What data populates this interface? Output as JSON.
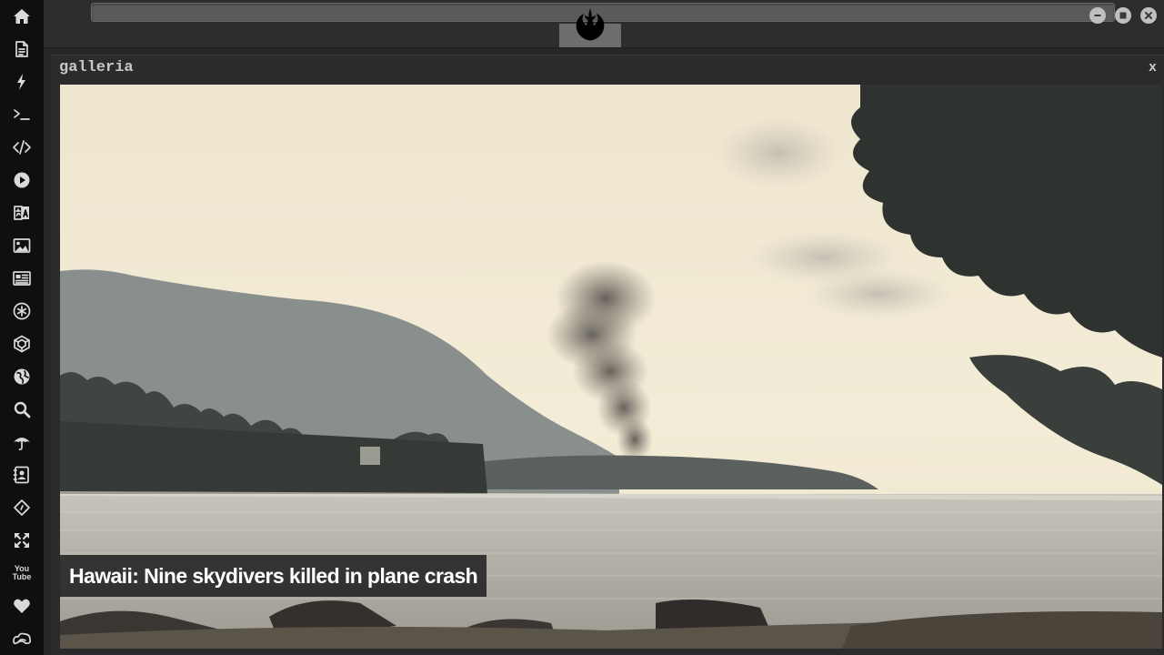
{
  "dock": {
    "items": [
      {
        "name": "home-icon"
      },
      {
        "name": "document-icon"
      },
      {
        "name": "lightning-icon"
      },
      {
        "name": "terminal-icon"
      },
      {
        "name": "code-icon"
      },
      {
        "name": "play-icon"
      },
      {
        "name": "translate-icon"
      },
      {
        "name": "image-icon"
      },
      {
        "name": "newspaper-icon"
      },
      {
        "name": "asterisk-badge-icon"
      },
      {
        "name": "hexagon-icon"
      },
      {
        "name": "globe-icon"
      },
      {
        "name": "search-icon"
      },
      {
        "name": "umbrella-icon"
      },
      {
        "name": "contacts-icon"
      },
      {
        "name": "link-code-icon"
      },
      {
        "name": "expand-icon"
      },
      {
        "name": "youtube-icon",
        "label_top": "You",
        "label_bottom": "Tube"
      },
      {
        "name": "heart-icon"
      },
      {
        "name": "infinity-cloud-icon"
      }
    ]
  },
  "topbar": {
    "address_value": "",
    "logo": "rebel-alliance-logo"
  },
  "window_controls": {
    "minimize": "minimize-icon",
    "maximize": "maximize-icon",
    "close": "close-icon"
  },
  "panel": {
    "title": "galleria",
    "close_label": "x"
  },
  "gallery": {
    "caption": "Hawaii: Nine skydivers killed in plane crash"
  }
}
